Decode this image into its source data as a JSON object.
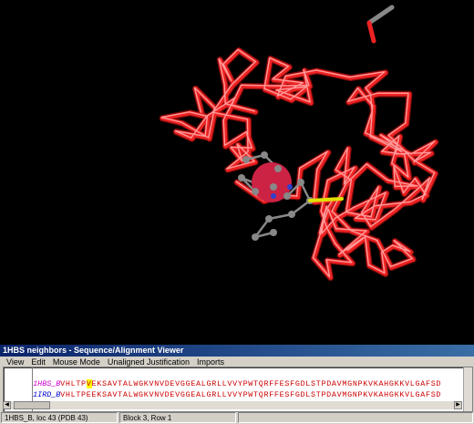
{
  "viewer": {
    "background": "#000000",
    "backbone_color": "#ee2222",
    "ligand_color": "#888888",
    "ion_color": "#cc2244"
  },
  "sequence_window": {
    "title": "1HBS neighbors - Sequence/Alignment Viewer",
    "menu": [
      "View",
      "Edit",
      "Mouse Mode",
      "Unaligned Justification",
      "Imports"
    ],
    "rows": [
      {
        "label": "1HBS_B",
        "seq_pre": "VHLTP",
        "seq_hl": "V",
        "seq_post": "EKSAVTALWGKVNVDEVGGEALGRLLVVYPWTQRFFESFGDLSTPDAVMGNPKVKAHGKKVLGAFSD"
      },
      {
        "label": "1IRD_B",
        "seq_pre": "VHLTPE",
        "seq_hl": "",
        "seq_post": "EKSAVTALWGKVNVDEVGGEALGRLLVVYPWTQRFFESFGDLSTPDAVMGNPKVKAHGKKVLGAFSD"
      }
    ],
    "status": [
      "1HBS_B, loc 43 (PDB 43)",
      "Block 3, Row 1"
    ]
  }
}
